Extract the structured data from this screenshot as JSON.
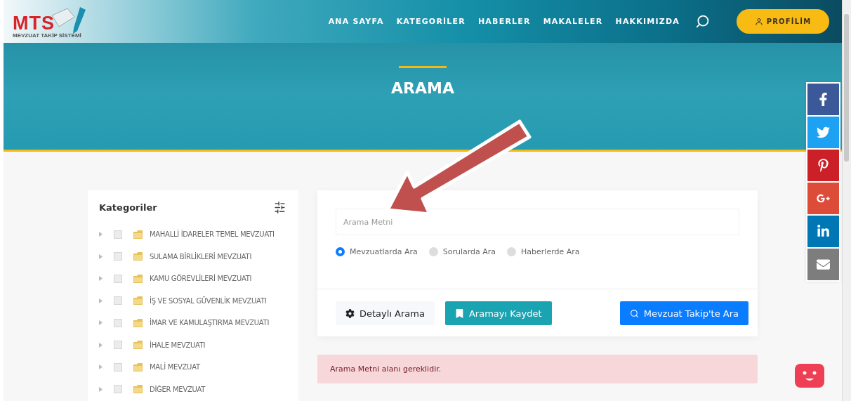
{
  "logo": {
    "title": "MTS",
    "subtitle": "MEVZUAT TAKİP SİSTEMİ"
  },
  "nav": {
    "items": [
      {
        "label": "ANA SAYFA"
      },
      {
        "label": "KATEGORİLER"
      },
      {
        "label": "HABERLER"
      },
      {
        "label": "MAKALELER"
      },
      {
        "label": "HAKKIMIZDA"
      }
    ],
    "profile_button": "PROFİLİM"
  },
  "hero": {
    "title": "ARAMA"
  },
  "sidebar": {
    "title": "Kategoriler",
    "items": [
      {
        "label": "MAHALLİ İDARELER TEMEL MEVZUATI",
        "checked": false
      },
      {
        "label": "SULAMA BİRLİKLERİ MEVZUATI",
        "checked": false
      },
      {
        "label": "KAMU GÖREVLİLERİ MEVZUATI",
        "checked": false
      },
      {
        "label": "İŞ VE SOSYAL GÜVENLİK MEVZUATI",
        "checked": false
      },
      {
        "label": "İMAR VE KAMULAŞTIRMA MEVZUATI",
        "checked": false
      },
      {
        "label": "İHALE MEVZUATI",
        "checked": false
      },
      {
        "label": "MALİ MEVZUAT",
        "checked": false
      },
      {
        "label": "DİĞER MEVZUAT",
        "checked": false
      }
    ]
  },
  "search": {
    "placeholder": "Arama Metni",
    "options": [
      {
        "label": "Mevzuatlarda Ara",
        "selected": true
      },
      {
        "label": "Sorularda Ara",
        "selected": false
      },
      {
        "label": "Haberlerde Ara",
        "selected": false
      }
    ],
    "buttons": [
      {
        "kind": "detail",
        "label": "Detaylı Arama"
      },
      {
        "kind": "save",
        "label": "Aramayı Kaydet"
      },
      {
        "kind": "search",
        "label": "Mevzuat Takip'te Ara"
      }
    ]
  },
  "alert": {
    "message": "Arama Metni alanı gereklidir."
  },
  "share": [
    {
      "kind": "facebook",
      "color": "#3b5998"
    },
    {
      "kind": "twitter",
      "color": "#1da1f2"
    },
    {
      "kind": "pinterest",
      "color": "#cb2027"
    },
    {
      "kind": "googleplus",
      "color": "#dd4b39"
    },
    {
      "kind": "linkedin",
      "color": "#0077b5"
    },
    {
      "kind": "email",
      "color": "#7d7d7d"
    }
  ]
}
